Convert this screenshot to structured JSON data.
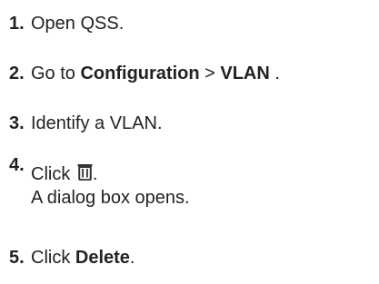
{
  "steps": [
    {
      "number": "1.",
      "text": "Open QSS."
    },
    {
      "number": "2.",
      "prefix": "Go to ",
      "bold1": "Configuration",
      "separator": " > ",
      "bold2": "VLAN",
      "suffix": " ."
    },
    {
      "number": "3.",
      "text": "Identify a VLAN."
    },
    {
      "number": "4.",
      "prefix": "Click ",
      "icon": "trash-icon",
      "suffix": ".",
      "subtext": "A dialog box opens."
    },
    {
      "number": "5.",
      "prefix": "Click ",
      "bold": "Delete",
      "suffix": "."
    }
  ]
}
